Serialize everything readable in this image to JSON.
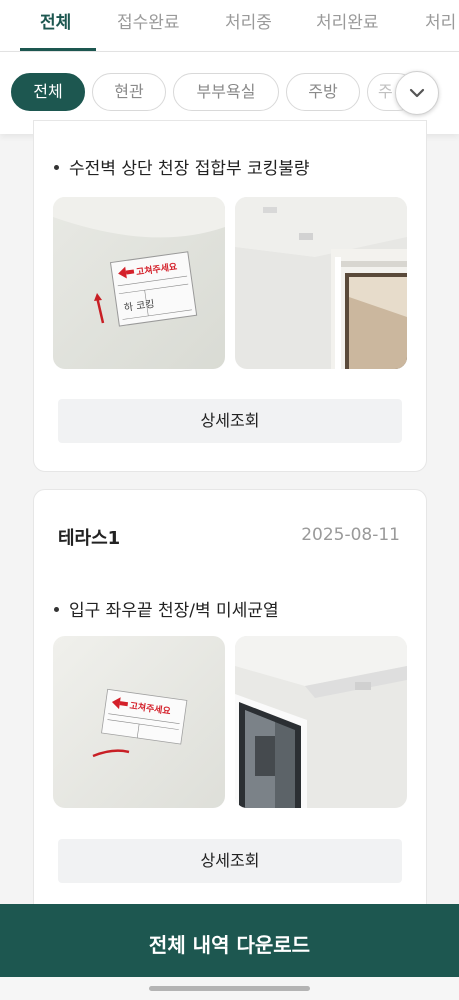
{
  "status_tabs": [
    {
      "label": "전체",
      "active": true
    },
    {
      "label": "접수완료",
      "active": false
    },
    {
      "label": "처리중",
      "active": false
    },
    {
      "label": "처리완료",
      "active": false
    },
    {
      "label": "처리",
      "active": false
    }
  ],
  "location_chips": [
    {
      "label": "전체",
      "active": true
    },
    {
      "label": "현관",
      "active": false
    },
    {
      "label": "부부욕실",
      "active": false
    },
    {
      "label": "주방",
      "active": false
    },
    {
      "label": "주",
      "active": false
    }
  ],
  "expand_icon": "chevron-down-icon",
  "cards": [
    {
      "title": "",
      "date": "",
      "description": "수전벽 상단 천장 접합부 코킹불량",
      "photo_labels": [
        "고쳐주세요",
        "하 코킹"
      ],
      "detail_label": "상세조회"
    },
    {
      "title": "테라스1",
      "date": "2025-08-11",
      "description": "입구 좌우끝 천장/벽 미세균열",
      "photo_labels": [
        "고쳐주세요"
      ],
      "detail_label": "상세조회"
    }
  ],
  "download_label": "전체 내역 다운로드",
  "colors": {
    "brand": "#1d5750",
    "accent_red": "#d4202a"
  }
}
